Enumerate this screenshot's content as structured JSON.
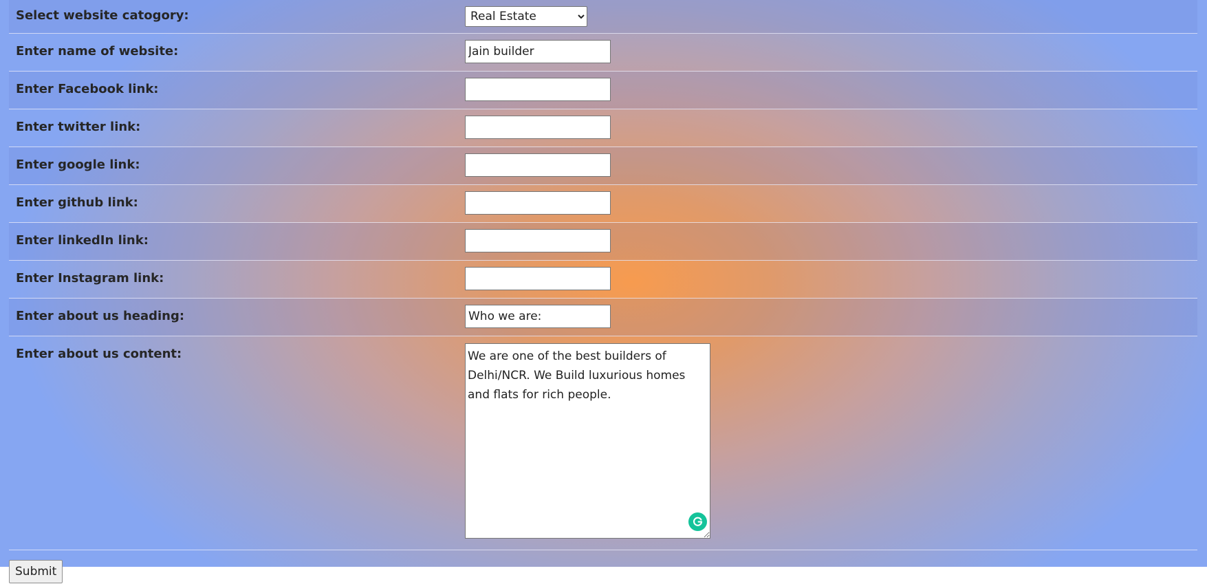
{
  "form": {
    "category": {
      "label": "Select website catogory:",
      "selected": "Real Estate",
      "options": [
        "Real Estate"
      ]
    },
    "website_name": {
      "label": "Enter name of website:",
      "value": "Jain builder"
    },
    "facebook": {
      "label": "Enter Facebook link:",
      "value": ""
    },
    "twitter": {
      "label": "Enter twitter link:",
      "value": ""
    },
    "google": {
      "label": "Enter google link:",
      "value": ""
    },
    "github": {
      "label": "Enter github link:",
      "value": ""
    },
    "linkedin": {
      "label": "Enter linkedIn link:",
      "value": ""
    },
    "instagram": {
      "label": "Enter Instagram link:",
      "value": ""
    },
    "about_heading": {
      "label": "Enter about us heading:",
      "value": "Who we are:"
    },
    "about_content": {
      "label": "Enter about us content:",
      "value": "We are one of the best builders of Delhi/NCR. We Build luxurious homes and flats for rich people."
    },
    "submit_label": "Submit"
  },
  "icons": {
    "grammarly": "grammarly-g-icon"
  },
  "colors": {
    "gradient_center": "#f79b4f",
    "gradient_edge": "#86a6f2",
    "grammarly_green": "#15c39a"
  }
}
